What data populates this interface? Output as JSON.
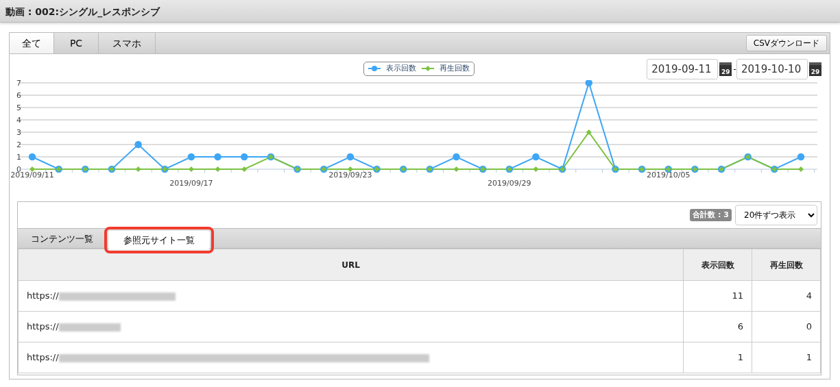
{
  "header": {
    "title": "動画 : 002:シングル_レスポンシブ"
  },
  "device_tabs": [
    {
      "label": "全て",
      "selected": true
    },
    {
      "label": "PC",
      "selected": false
    },
    {
      "label": "スマホ",
      "selected": false
    }
  ],
  "csv_button": "CSVダウンロード",
  "date_range": {
    "from": "2019-09-11",
    "from_calendar_day": "29",
    "separator": "-",
    "to": "2019-10-10",
    "to_calendar_day": "29"
  },
  "chart": {
    "chart_data": {
      "type": "line",
      "categories": [
        "2019/09/11",
        null,
        null,
        null,
        null,
        null,
        "2019/09/17",
        null,
        null,
        null,
        null,
        null,
        "2019/09/23",
        null,
        null,
        null,
        null,
        null,
        "2019/09/29",
        null,
        null,
        null,
        null,
        null,
        "2019/10/05",
        null,
        null,
        null,
        null,
        null
      ],
      "grid": true,
      "series": [
        {
          "name": "表示回数",
          "color": "#3ea6f5",
          "marker": "circle",
          "values": [
            1,
            0,
            0,
            0,
            2,
            0,
            1,
            1,
            1,
            1,
            0,
            0,
            1,
            0,
            0,
            0,
            1,
            0,
            0,
            1,
            0,
            7,
            0,
            0,
            0,
            0,
            0,
            1,
            0,
            1
          ]
        },
        {
          "name": "再生回数",
          "color": "#7dc242",
          "marker": "diamond",
          "values": [
            0,
            0,
            0,
            0,
            0,
            0,
            0,
            0,
            0,
            1,
            0,
            0,
            0,
            0,
            0,
            0,
            0,
            0,
            0,
            0,
            0,
            3,
            0,
            0,
            0,
            0,
            0,
            1,
            0,
            0
          ]
        }
      ],
      "ylim": [
        0,
        7
      ],
      "yticks": [
        0,
        1,
        2,
        3,
        4,
        5,
        6,
        7
      ]
    }
  },
  "total_badge": "合計数 : 3",
  "page_size_select": "20件ずつ表示",
  "list_tabs": [
    {
      "label": "コンテンツ一覧",
      "selected": false
    },
    {
      "label": "参照元サイト一覧",
      "selected": true,
      "highlighted": true
    }
  ],
  "table": {
    "columns": [
      "URL",
      "表示回数",
      "再生回数"
    ],
    "rows": [
      {
        "url": "https://",
        "blurred": true,
        "views": "11",
        "plays": "4"
      },
      {
        "url": "https://",
        "blurred": true,
        "views": "6",
        "plays": "0"
      },
      {
        "url": "https://",
        "blurred": true,
        "views": "1",
        "plays": "1"
      }
    ]
  }
}
